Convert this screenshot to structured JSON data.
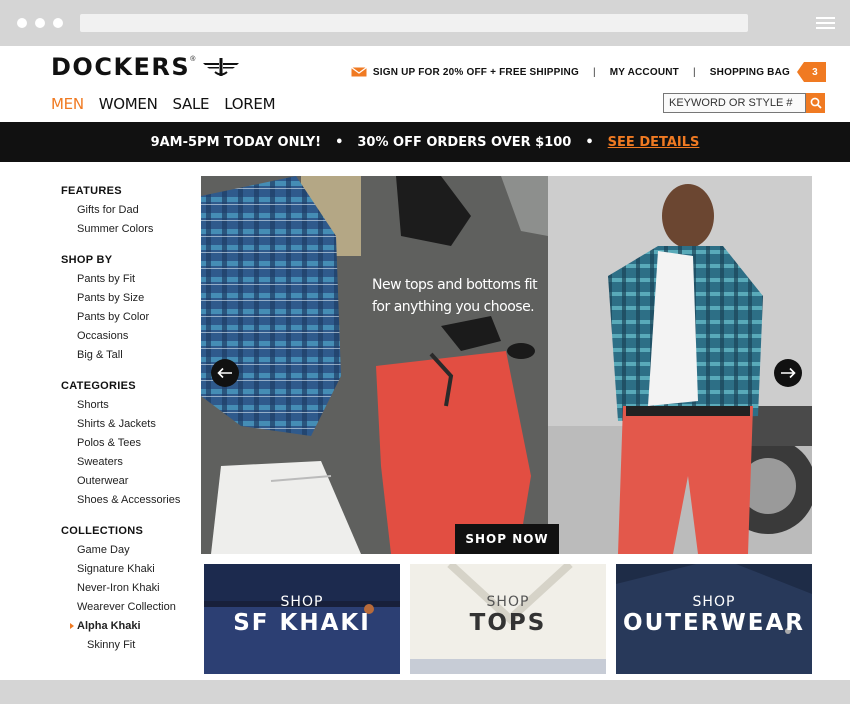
{
  "brand": {
    "name": "DOCKERS",
    "registered": "®",
    "accent": "#f07a22"
  },
  "header": {
    "signup_label": "SIGN UP FOR 20% OFF + FREE SHIPPING",
    "separator": "|",
    "account_label": "MY ACCOUNT",
    "bag_label": "SHOPPING BAG",
    "bag_count": "3"
  },
  "nav": {
    "items": [
      "MEN",
      "WOMEN",
      "SALE",
      "LOREM"
    ],
    "active": "MEN"
  },
  "search": {
    "placeholder": "KEYWORD OR STYLE #"
  },
  "promo": {
    "part1": "9AM-5PM TODAY ONLY!",
    "bullet": "•",
    "part2": "30% OFF ORDERS OVER $100",
    "details": "SEE DETAILS"
  },
  "sidebar": {
    "groups": [
      {
        "heading": "FEATURES",
        "items": [
          "Gifts for Dad",
          "Summer Colors"
        ]
      },
      {
        "heading": "SHOP BY",
        "items": [
          "Pants by Fit",
          "Pants by Size",
          "Pants by Color",
          "Occasions",
          "Big & Tall"
        ]
      },
      {
        "heading": "CATEGORIES",
        "items": [
          "Shorts",
          "Shirts & Jackets",
          "Polos & Tees",
          "Sweaters",
          "Outerwear",
          "Shoes & Accessories"
        ]
      },
      {
        "heading": "COLLECTIONS",
        "items": [
          "Game Day",
          "Signature Khaki",
          "Never-Iron Khaki",
          "Wearever Collection",
          "Alpha Khaki",
          "Skinny Fit"
        ]
      }
    ]
  },
  "hero": {
    "copy_line1": "New tops and bottoms fit",
    "copy_line2": "for anything you choose.",
    "cta": "SHOP NOW"
  },
  "tiles": [
    {
      "small": "SHOP",
      "big": "SF KHAKI"
    },
    {
      "small": "SHOP",
      "big": "TOPS"
    },
    {
      "small": "SHOP",
      "big": "OUTERWEAR"
    }
  ]
}
